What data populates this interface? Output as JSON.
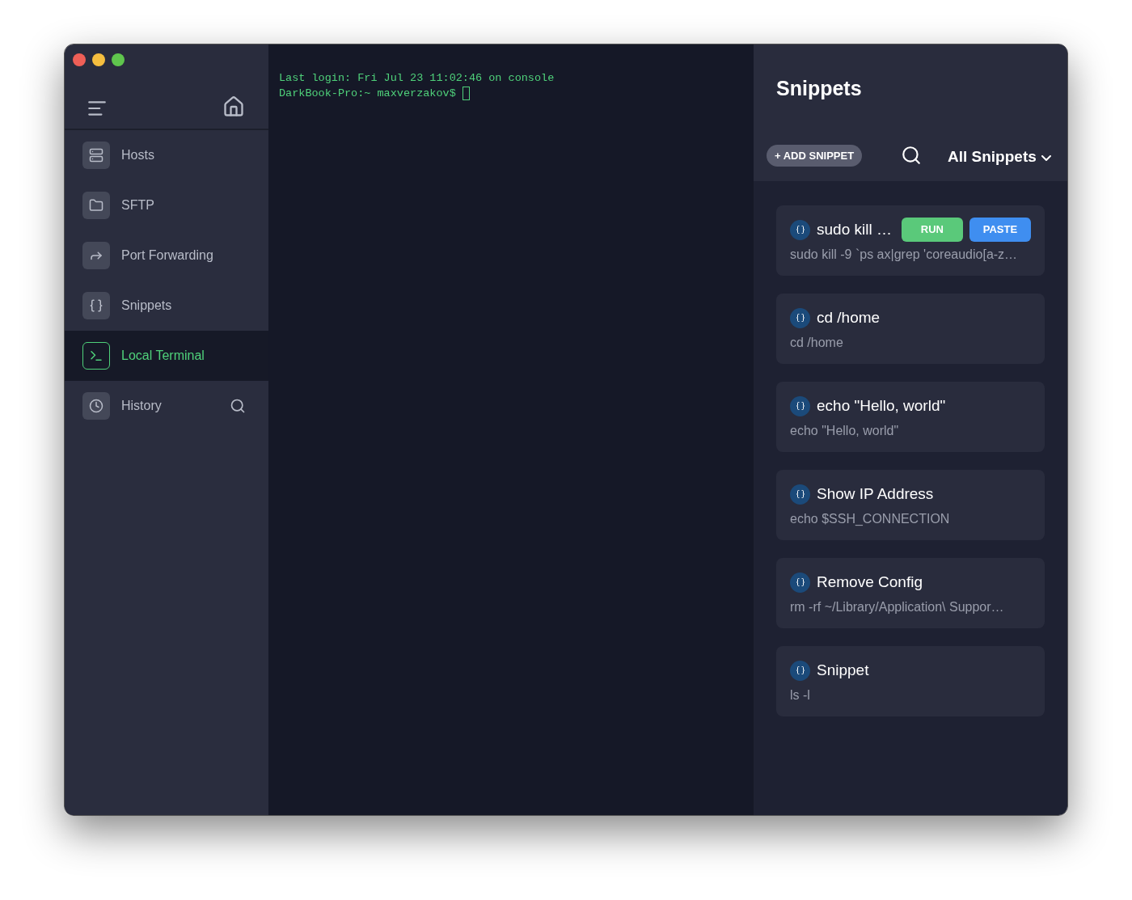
{
  "sidebar": {
    "items": [
      {
        "label": "Hosts",
        "selected": false
      },
      {
        "label": "SFTP",
        "selected": false
      },
      {
        "label": "Port Forwarding",
        "selected": false
      },
      {
        "label": "Snippets",
        "selected": false
      },
      {
        "label": "Local Terminal",
        "selected": true
      },
      {
        "label": "History",
        "selected": false
      }
    ]
  },
  "terminal": {
    "lines": [
      "Last login: Fri Jul 23 11:02:46 on console",
      "DarkBook-Pro:~ maxverzakov$"
    ]
  },
  "snippets_panel": {
    "title": "Snippets",
    "add_button": "+ ADD SNIPPET",
    "filter": "All Snippets",
    "snippets": [
      {
        "name": "sudo kill …",
        "command": "sudo kill -9 `ps ax|grep 'coreaudio[a-z…",
        "buttons": [
          {
            "label": "RUN",
            "color": "#5ac97a"
          },
          {
            "label": "PASTE",
            "color": "#3f8ef0"
          }
        ]
      },
      {
        "name": "cd /home",
        "command": "cd /home"
      },
      {
        "name": "echo \"Hello, world\"",
        "command": "echo \"Hello, world\""
      },
      {
        "name": "Show IP Address",
        "command": "echo $SSH_CONNECTION"
      },
      {
        "name": "Remove Config",
        "command": "rm -rf ~/Library/Application\\ Suppor…"
      },
      {
        "name": "Snippet",
        "command": "ls -l"
      }
    ]
  }
}
